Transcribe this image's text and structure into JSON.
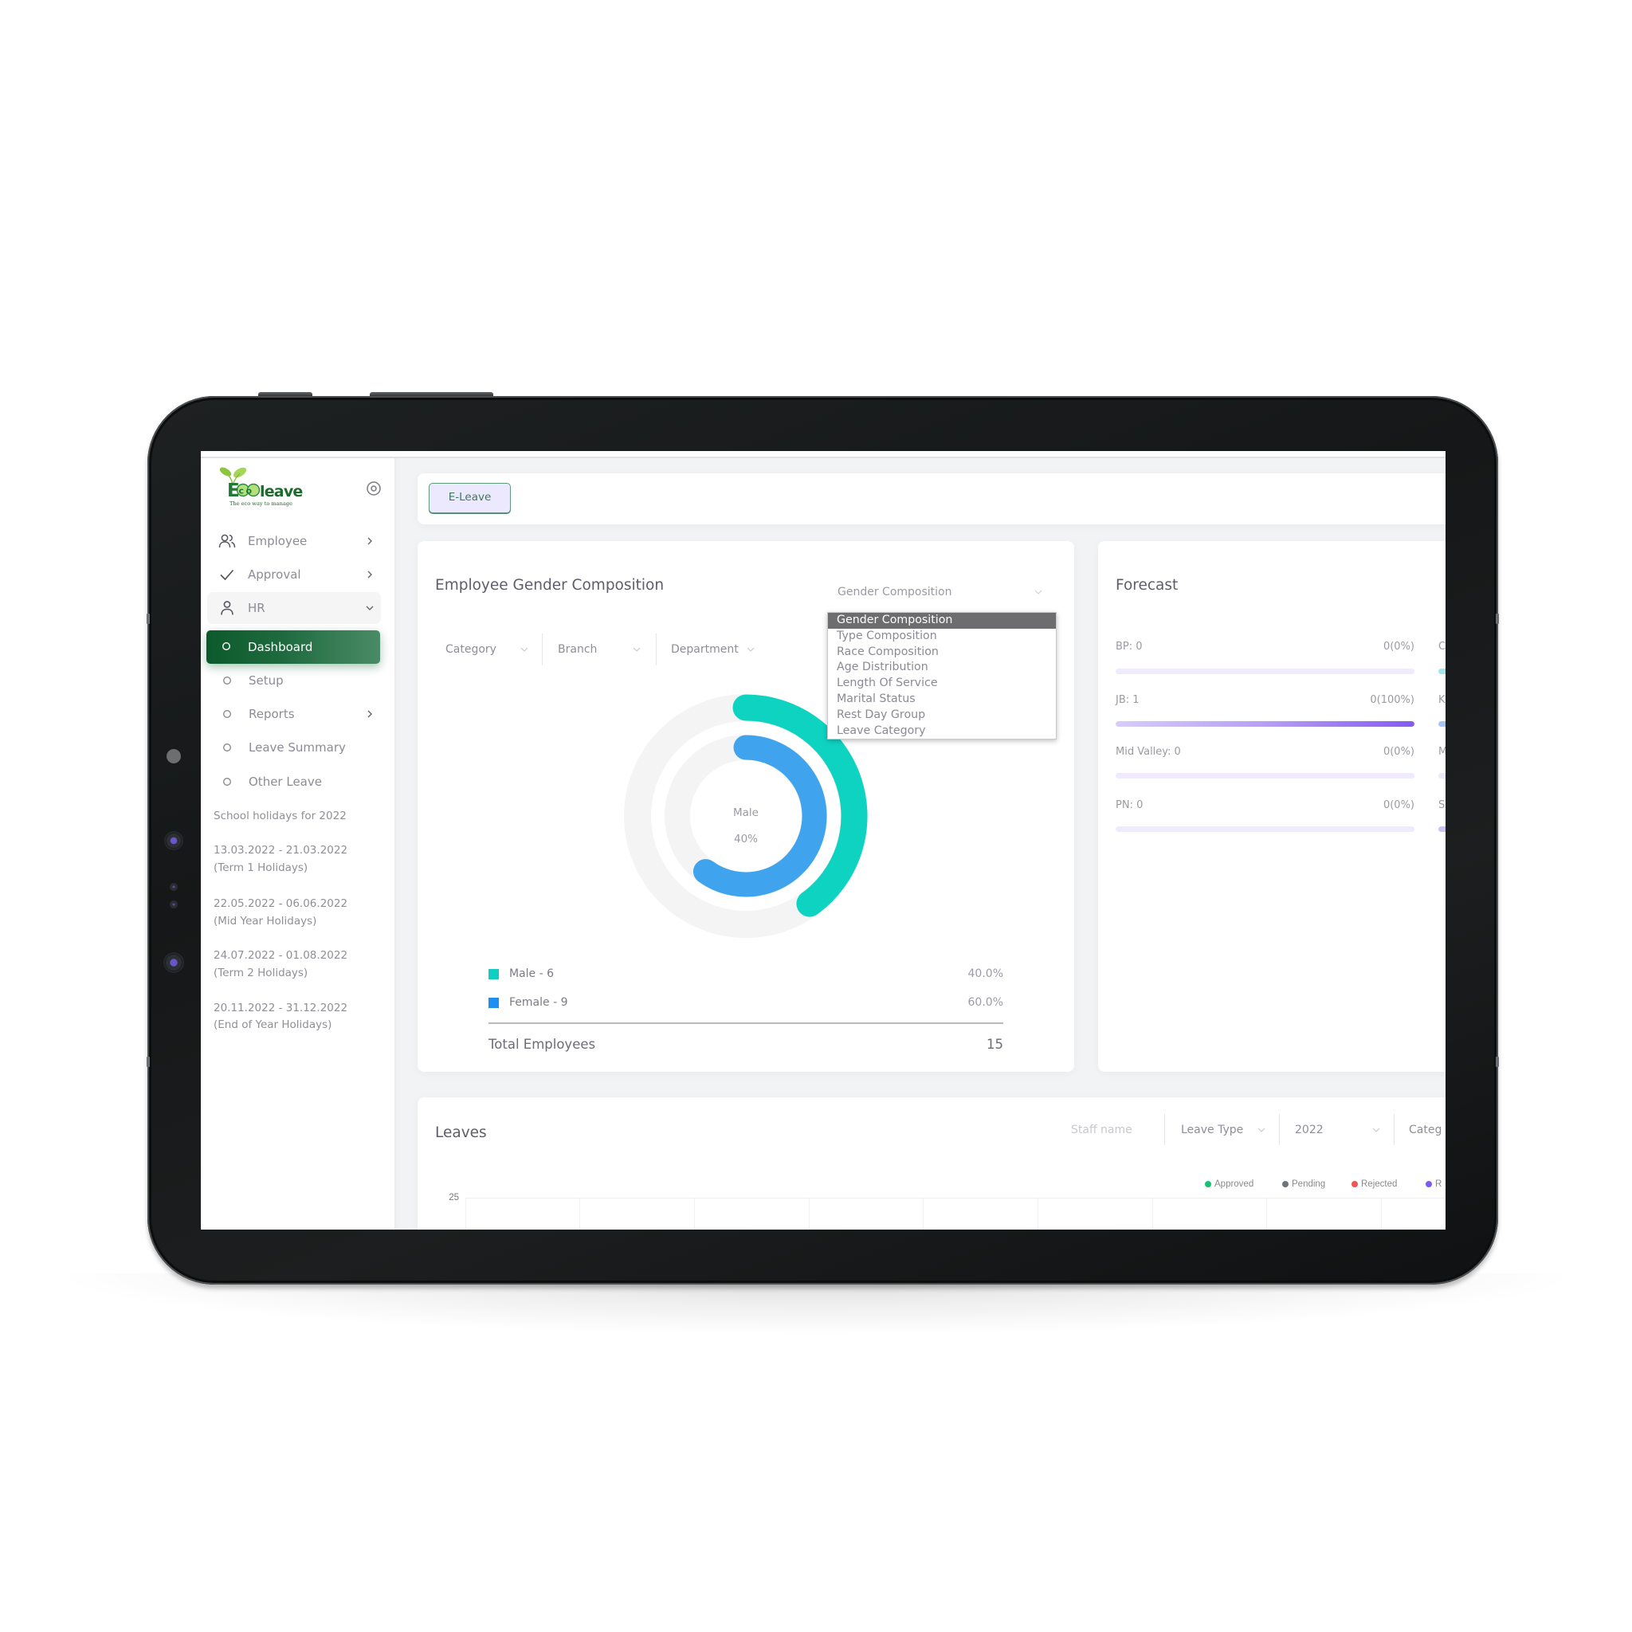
{
  "theme": {
    "brand_green": "#1a6b3c",
    "male_color": "#0fd3c1",
    "female_color": "#3fa3ee",
    "track_color": "#f4f4f5",
    "forecast_fill": "#8559f1",
    "approved": "#16c172",
    "pending": "#6c757d",
    "rejected": "#f05454",
    "fourth_status": "#7c5cf0"
  },
  "sidebar": {
    "logo": {
      "brand_first": "E",
      "brand_circles": "co",
      "brand_rest": "leave",
      "tagline": "The eco way to manage"
    },
    "settings_icon": "settings-icon",
    "nav": [
      {
        "label": "Employee",
        "icon": "users-icon",
        "chevron": "chevron-right-icon"
      },
      {
        "label": "Approval",
        "icon": "check-icon",
        "chevron": "chevron-right-icon"
      },
      {
        "label": "HR",
        "icon": "user-icon",
        "chevron": "chevron-down-icon",
        "expanded": true
      }
    ],
    "hr_sub_nav": [
      {
        "label": "Dashboard",
        "active": true
      },
      {
        "label": "Setup"
      },
      {
        "label": "Reports",
        "chevron": "chevron-right-icon"
      },
      {
        "label": "Leave Summary"
      },
      {
        "label": "Other Leave"
      }
    ],
    "holidays": {
      "title": "School holidays for 2022",
      "items": [
        {
          "dates": "13.03.2022 - 21.03.2022",
          "name": "(Term 1 Holidays)"
        },
        {
          "dates": "22.05.2022 - 06.06.2022",
          "name": "(Mid Year Holidays)"
        },
        {
          "dates": "24.07.2022 - 01.08.2022",
          "name": "(Term 2 Holidays)"
        },
        {
          "dates": "20.11.2022 - 31.12.2022",
          "name": "(End of Year Holidays)"
        }
      ]
    }
  },
  "topbar": {
    "module_button": "E-Leave"
  },
  "gender_card": {
    "title": "Employee Gender Composition",
    "select_value": "Gender Composition",
    "dropdown": {
      "selected": "Gender Composition",
      "options": [
        "Gender Composition",
        "Type Composition",
        "Race Composition",
        "Age Distribution",
        "Length Of Service",
        "Marital Status",
        "Rest Day Group",
        "Leave Category"
      ]
    },
    "filters": [
      "Category",
      "Branch",
      "Department"
    ],
    "center_label": "Male",
    "center_value": "40%",
    "legend": [
      {
        "label": "Male - 6",
        "percent": "40.0%",
        "color": "#10cfc0"
      },
      {
        "label": "Female - 9",
        "percent": "60.0%",
        "color": "#1e8ff0"
      }
    ],
    "total_label": "Total Employees",
    "total_value": "15"
  },
  "forecast_card": {
    "title": "Forecast",
    "rows": [
      {
        "label": "BP: 0",
        "value": "0(0%)",
        "fill": 0
      },
      {
        "label": "JB: 1",
        "value": "0(100%)",
        "fill": 1.0
      },
      {
        "label": "Mid Valley: 0",
        "value": "0(0%)",
        "fill": 0
      },
      {
        "label": "PN: 0",
        "value": "0(0%)",
        "fill": 0
      }
    ],
    "second_column_partial": [
      {
        "label": "C",
        "color": "#9ee9ec"
      },
      {
        "label": "K",
        "color": "#a6c6f7"
      },
      {
        "label": "M",
        "color": "#eeeafc"
      },
      {
        "label": "S",
        "color": "#cfc0f8"
      }
    ]
  },
  "leaves_card": {
    "title": "Leaves",
    "staff_name_placeholder": "Staff name",
    "leave_type": "Leave Type",
    "year": "2022",
    "category_partial": "Categ",
    "legend": [
      {
        "label": "Approved",
        "color": "#16c172"
      },
      {
        "label": "Pending",
        "color": "#6c757d"
      },
      {
        "label": "Rejected",
        "color": "#f05454"
      },
      {
        "label": "R",
        "color": "#7c5cf0"
      }
    ],
    "y_ticks": [
      "25"
    ]
  },
  "chart_data": {
    "type": "pie",
    "style": "radial-rings",
    "title": "Employee Gender Composition",
    "categories": [
      "Male",
      "Female"
    ],
    "values": [
      6,
      9
    ],
    "percentages": [
      40.0,
      60.0
    ],
    "total": 15,
    "colors": [
      "#0fd3c1",
      "#3fa3ee"
    ],
    "legend": "bottom"
  }
}
